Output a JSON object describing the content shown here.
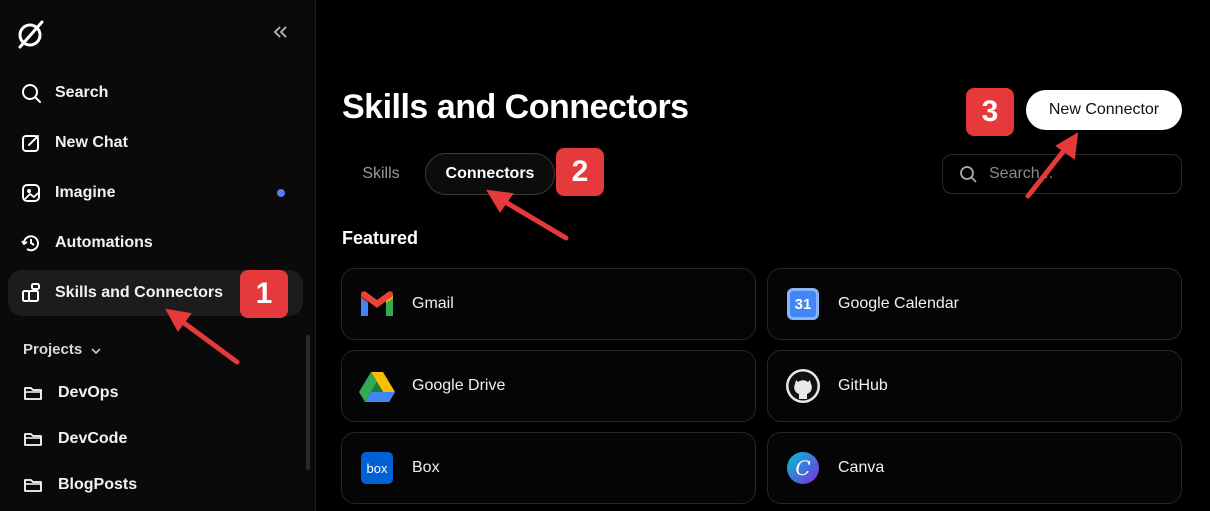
{
  "sidebar": {
    "nav": [
      {
        "label": "Search",
        "icon": "search-icon"
      },
      {
        "label": "New Chat",
        "icon": "edit-icon"
      },
      {
        "label": "Imagine",
        "icon": "image-icon"
      },
      {
        "label": "Automations",
        "icon": "clock-icon"
      },
      {
        "label": "Skills and Connectors",
        "icon": "grid-plus-icon"
      }
    ],
    "projects_label": "Projects",
    "projects": [
      {
        "label": "DevOps"
      },
      {
        "label": "DevCode"
      },
      {
        "label": "BlogPosts"
      }
    ]
  },
  "main": {
    "title": "Skills and Connectors",
    "tabs": [
      {
        "label": "Skills"
      },
      {
        "label": "Connectors"
      }
    ],
    "search_placeholder": "Search...",
    "new_connector_label": "New Connector",
    "featured_label": "Featured",
    "connectors": [
      {
        "name": "Gmail",
        "icon": "gmail-icon"
      },
      {
        "name": "Google Calendar",
        "icon": "google-calendar-icon",
        "icon_text": "31"
      },
      {
        "name": "Google Drive",
        "icon": "google-drive-icon"
      },
      {
        "name": "GitHub",
        "icon": "github-icon"
      },
      {
        "name": "Box",
        "icon": "box-icon",
        "icon_text": "box"
      },
      {
        "name": "Canva",
        "icon": "canva-icon",
        "icon_text": "C"
      }
    ]
  },
  "annotations": [
    "1",
    "2",
    "3"
  ],
  "colors": {
    "accent_dot": "#5b7be8",
    "badge": "#e5393b",
    "background": "#000000"
  }
}
